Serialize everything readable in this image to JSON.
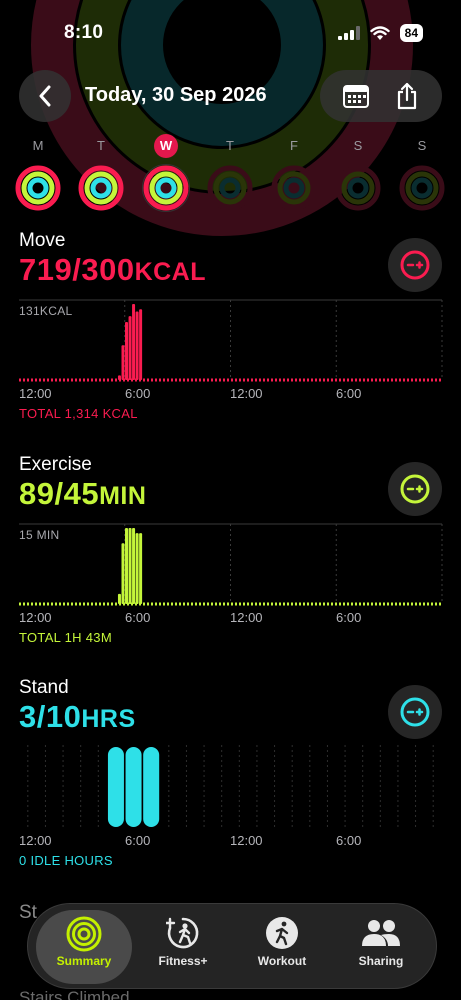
{
  "status_bar": {
    "time": "8:10",
    "battery": "84"
  },
  "header": {
    "title": "Today, 30 Sep 2026"
  },
  "week": {
    "days": [
      {
        "letter": "M",
        "today": false,
        "active": true
      },
      {
        "letter": "T",
        "today": false,
        "active": true
      },
      {
        "letter": "W",
        "today": true,
        "active": true
      },
      {
        "letter": "T",
        "today": false,
        "active": false
      },
      {
        "letter": "F",
        "today": false,
        "active": false
      },
      {
        "letter": "S",
        "today": false,
        "active": false
      },
      {
        "letter": "S",
        "today": false,
        "active": false
      }
    ]
  },
  "colors": {
    "move": "#fa1c50",
    "exercise": "#c4f53a",
    "stand": "#2ee0e8"
  },
  "move": {
    "name": "Move",
    "value": "719/300",
    "unit": "KCAL",
    "max_label": "131KCAL",
    "total": "TOTAL 1,314 KCAL",
    "chart_data": {
      "type": "bar",
      "x_ticks": [
        "12:00",
        "6:00",
        "12:00",
        "6:00"
      ],
      "bars": [
        {
          "hour": 5.7,
          "value": 8
        },
        {
          "hour": 5.9,
          "value": 60
        },
        {
          "hour": 6.1,
          "value": 100
        },
        {
          "hour": 6.3,
          "value": 110
        },
        {
          "hour": 6.5,
          "value": 131
        },
        {
          "hour": 6.7,
          "value": 118
        },
        {
          "hour": 6.9,
          "value": 122
        }
      ],
      "ylim": [
        0,
        131
      ]
    }
  },
  "exercise": {
    "name": "Exercise",
    "value": "89/45",
    "unit": "MIN",
    "max_label": "15 MIN",
    "total": "TOTAL 1H 43M",
    "chart_data": {
      "type": "bar",
      "x_ticks": [
        "12:00",
        "6:00",
        "12:00",
        "6:00"
      ],
      "bars": [
        {
          "hour": 5.7,
          "value": 2
        },
        {
          "hour": 5.9,
          "value": 12
        },
        {
          "hour": 6.1,
          "value": 15
        },
        {
          "hour": 6.3,
          "value": 15
        },
        {
          "hour": 6.5,
          "value": 15
        },
        {
          "hour": 6.7,
          "value": 14
        },
        {
          "hour": 6.9,
          "value": 14
        }
      ],
      "ylim": [
        0,
        15
      ]
    }
  },
  "stand": {
    "name": "Stand",
    "value": "3/10",
    "unit": "HRS",
    "total": "0 IDLE HOURS",
    "chart_data": {
      "type": "bar",
      "x_ticks": [
        "12:00",
        "6:00",
        "12:00",
        "6:00"
      ],
      "stood_hours": [
        5,
        6,
        7
      ]
    }
  },
  "peek": {
    "label": "St",
    "label2": "Stairs Climbed"
  },
  "tabs": [
    {
      "label": "Summary"
    },
    {
      "label": "Fitness+"
    },
    {
      "label": "Workout"
    },
    {
      "label": "Sharing"
    }
  ]
}
